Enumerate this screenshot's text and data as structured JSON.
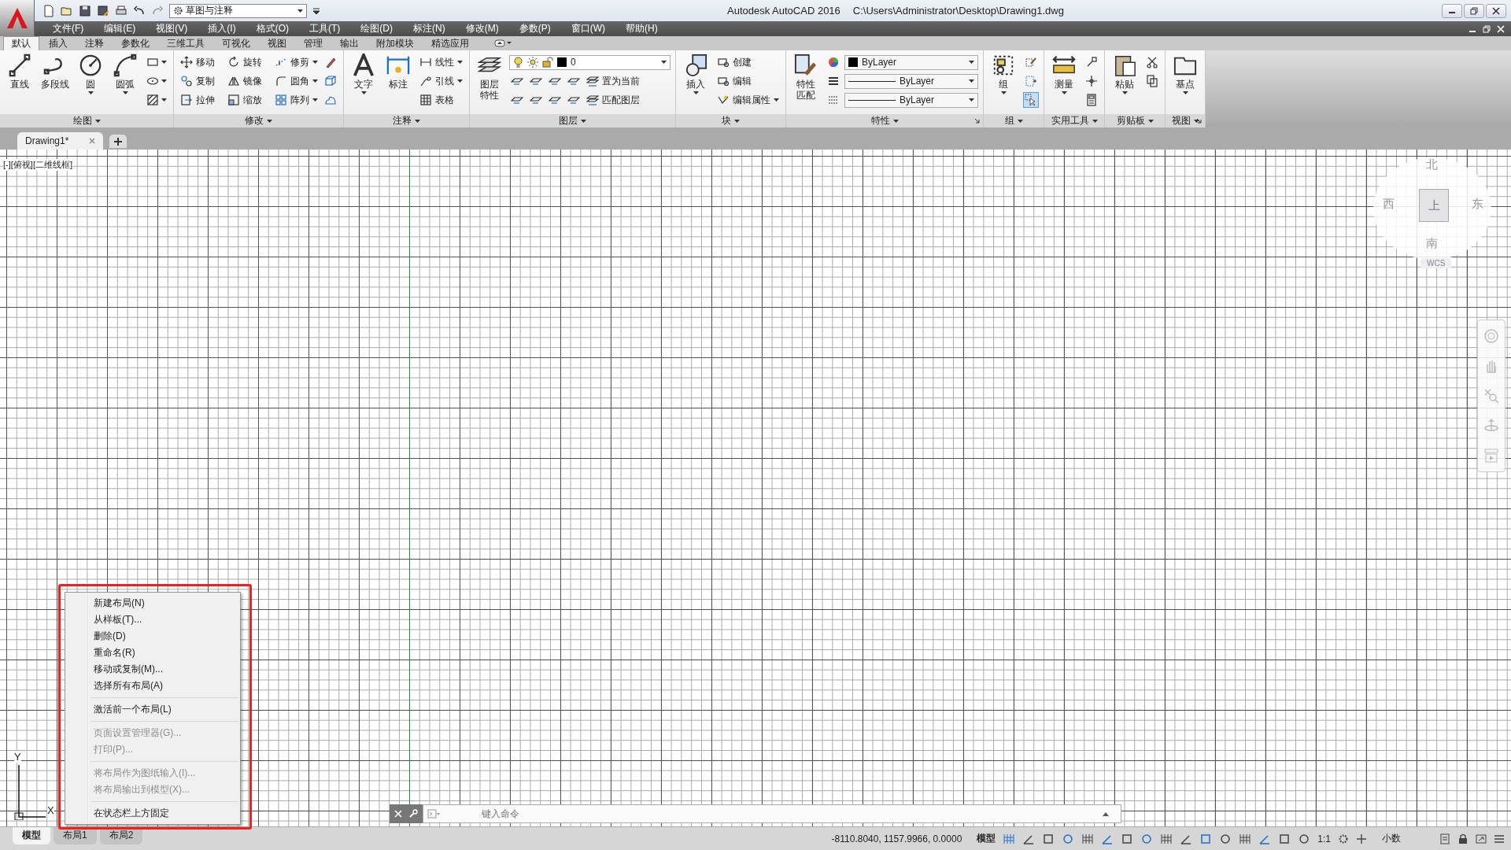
{
  "title_bar": {
    "app": "Autodesk AutoCAD 2016",
    "file": "C:\\Users\\Administrator\\Desktop\\Drawing1.dwg"
  },
  "workspace": "草图与注释",
  "menu": [
    "文件(F)",
    "编辑(E)",
    "视图(V)",
    "插入(I)",
    "格式(O)",
    "工具(T)",
    "绘图(D)",
    "标注(N)",
    "修改(M)",
    "参数(P)",
    "窗口(W)",
    "帮助(H)"
  ],
  "ribbon_tabs": [
    {
      "label": "默认",
      "selected": true
    },
    {
      "label": "插入",
      "selected": false
    },
    {
      "label": "注释",
      "selected": false
    },
    {
      "label": "参数化",
      "selected": false
    },
    {
      "label": "三维工具",
      "selected": false
    },
    {
      "label": "可视化",
      "selected": false
    },
    {
      "label": "视图",
      "selected": false
    },
    {
      "label": "管理",
      "selected": false
    },
    {
      "label": "输出",
      "selected": false
    },
    {
      "label": "附加模块",
      "selected": false
    },
    {
      "label": "精选应用",
      "selected": false
    }
  ],
  "panels": [
    {
      "title": "绘图",
      "launcher": false,
      "large": [
        {
          "label": "直线",
          "dropdown": false
        },
        {
          "label": "多段线",
          "dropdown": false
        },
        {
          "label": "圆",
          "dropdown": true
        },
        {
          "label": "圆弧",
          "dropdown": true
        }
      ],
      "rows": [
        [
          {
            "kind": "icon",
            "dropdown": true
          }
        ],
        [
          {
            "kind": "icon",
            "dropdown": true
          }
        ],
        [
          {
            "kind": "icon",
            "dropdown": true
          }
        ]
      ]
    },
    {
      "title": "修改",
      "launcher": false,
      "rows": [
        [
          {
            "kind": "small",
            "label": "移动",
            "dropdown": false
          },
          {
            "kind": "small",
            "label": "旋转",
            "dropdown": false
          },
          {
            "kind": "small",
            "label": "修剪",
            "dropdown": true
          },
          {
            "kind": "icon",
            "dropdown": false
          }
        ],
        [
          {
            "kind": "small",
            "label": "复制",
            "dropdown": false
          },
          {
            "kind": "small",
            "label": "镜像",
            "dropdown": false
          },
          {
            "kind": "small",
            "label": "圆角",
            "dropdown": true
          },
          {
            "kind": "icon",
            "dropdown": false
          }
        ],
        [
          {
            "kind": "small",
            "label": "拉伸",
            "dropdown": false
          },
          {
            "kind": "small",
            "label": "缩放",
            "dropdown": false
          },
          {
            "kind": "small",
            "label": "阵列",
            "dropdown": true
          },
          {
            "kind": "icon",
            "dropdown": false
          }
        ]
      ]
    },
    {
      "title": "注释",
      "launcher": false,
      "large": [
        {
          "label": "文字",
          "dropdown": true
        },
        {
          "label": "标注",
          "dropdown": false
        }
      ],
      "rows": [
        [
          {
            "kind": "small",
            "label": "线性",
            "dropdown": true
          }
        ],
        [
          {
            "kind": "small",
            "label": "引线",
            "dropdown": true
          }
        ],
        [
          {
            "kind": "small",
            "label": "表格",
            "dropdown": false
          }
        ]
      ]
    },
    {
      "title": "图层",
      "launcher": false,
      "large": [
        {
          "label": "图层特性",
          "dropdown": false
        }
      ],
      "rows": [
        [
          {
            "kind": "layer_combo",
            "value": "0"
          }
        ],
        [
          {
            "kind": "icon",
            "dropdown": false
          },
          {
            "kind": "icon",
            "dropdown": false
          },
          {
            "kind": "icon",
            "dropdown": false
          },
          {
            "kind": "icon",
            "dropdown": false
          },
          {
            "kind": "small",
            "label": "置为当前",
            "dropdown": false
          }
        ],
        [
          {
            "kind": "icon",
            "dropdown": false
          },
          {
            "kind": "icon",
            "dropdown": false
          },
          {
            "kind": "icon",
            "dropdown": false
          },
          {
            "kind": "icon",
            "dropdown": false
          },
          {
            "kind": "small",
            "label": "匹配图层",
            "dropdown": false
          }
        ]
      ]
    },
    {
      "title": "块",
      "launcher": false,
      "large": [
        {
          "label": "插入",
          "dropdown": true
        }
      ],
      "rows": [
        [
          {
            "kind": "small",
            "label": "创建",
            "dropdown": false
          }
        ],
        [
          {
            "kind": "small",
            "label": "编辑",
            "dropdown": false
          }
        ],
        [
          {
            "kind": "small",
            "label": "编辑属性",
            "dropdown": true
          }
        ]
      ]
    },
    {
      "title": "特性",
      "launcher": true,
      "large": [
        {
          "label": "特性匹配",
          "dropdown": false
        }
      ],
      "rows": [
        [
          {
            "kind": "icon",
            "dropdown": false
          },
          {
            "kind": "color_combo",
            "value": "ByLayer"
          }
        ],
        [
          {
            "kind": "icon",
            "dropdown": false
          },
          {
            "kind": "line_combo",
            "value": "ByLayer"
          }
        ],
        [
          {
            "kind": "icon",
            "dropdown": false
          },
          {
            "kind": "line_combo",
            "value": "ByLayer"
          }
        ]
      ]
    },
    {
      "title": "组",
      "launcher": false,
      "large": [
        {
          "label": "组",
          "dropdown": true
        }
      ],
      "rows": [
        [
          {
            "kind": "icon",
            "dropdown": false,
            "on": false
          }
        ],
        [
          {
            "kind": "icon",
            "dropdown": false,
            "on": false
          }
        ],
        [
          {
            "kind": "icon",
            "dropdown": false,
            "on": true
          }
        ]
      ]
    },
    {
      "title": "实用工具",
      "launcher": false,
      "large": [
        {
          "label": "测量",
          "dropdown": true
        }
      ],
      "rows": [
        [
          {
            "kind": "icon",
            "dropdown": false
          }
        ],
        [
          {
            "kind": "icon",
            "dropdown": false
          }
        ],
        [
          {
            "kind": "icon",
            "dropdown": false
          }
        ]
      ]
    },
    {
      "title": "剪贴板",
      "launcher": false,
      "large": [
        {
          "label": "粘贴",
          "dropdown": true
        }
      ],
      "rows": [
        [
          {
            "kind": "icon",
            "dropdown": false
          }
        ],
        [
          {
            "kind": "icon",
            "dropdown": false
          }
        ]
      ]
    },
    {
      "title": "视图",
      "launcher": true,
      "large": [
        {
          "label": "基点",
          "dropdown": true
        }
      ]
    }
  ],
  "doc_tabs": [
    {
      "label": "Drawing1*",
      "selected": true
    }
  ],
  "viewport_label": "[-][俯视][二维线框]",
  "viewcube": {
    "north": "北",
    "west": "西",
    "east": "东",
    "south": "南",
    "face": "上",
    "ucs": "WCS"
  },
  "ucs_icon": {
    "x": "X",
    "y": "Y"
  },
  "context_menu": [
    {
      "kind": "item",
      "label": "新建布局(N)",
      "disabled": false
    },
    {
      "kind": "item",
      "label": "从样板(T)...",
      "disabled": false
    },
    {
      "kind": "item",
      "label": "删除(D)",
      "disabled": false
    },
    {
      "kind": "item",
      "label": "重命名(R)",
      "disabled": false
    },
    {
      "kind": "item",
      "label": "移动或复制(M)...",
      "disabled": false
    },
    {
      "kind": "item",
      "label": "选择所有布局(A)",
      "disabled": false
    },
    {
      "kind": "separator"
    },
    {
      "kind": "item",
      "label": "激活前一个布局(L)",
      "disabled": false
    },
    {
      "kind": "separator"
    },
    {
      "kind": "item",
      "label": "页面设置管理器(G)...",
      "disabled": true
    },
    {
      "kind": "item",
      "label": "打印(P)...",
      "disabled": true
    },
    {
      "kind": "separator"
    },
    {
      "kind": "item",
      "label": "将布局作为图纸输入(I)...",
      "disabled": true
    },
    {
      "kind": "item",
      "label": "将布局输出到模型(X)...",
      "disabled": true
    },
    {
      "kind": "separator"
    },
    {
      "kind": "item",
      "label": "在状态栏上方固定",
      "disabled": false
    }
  ],
  "command_line": {
    "placeholder": "键入命令"
  },
  "layout_tabs": [
    {
      "label": "模型",
      "selected": true
    },
    {
      "label": "布局1",
      "selected": false
    },
    {
      "label": "布局2",
      "selected": false
    }
  ],
  "status_bar": {
    "coordinates": "-8110.8040, 1157.9966, 0.0000",
    "space": "模型",
    "scale": "1:1",
    "units": "小数",
    "toggles": [
      {
        "on": true
      },
      {
        "on": false
      },
      {
        "on": false
      },
      {
        "on": true
      },
      {
        "on": false
      },
      {
        "on": true
      },
      {
        "on": false
      },
      {
        "on": true
      },
      {
        "on": false
      },
      {
        "on": false
      },
      {
        "on": true
      },
      {
        "on": false
      },
      {
        "on": false
      },
      {
        "on": true
      },
      {
        "on": false
      },
      {
        "on": false
      }
    ]
  }
}
